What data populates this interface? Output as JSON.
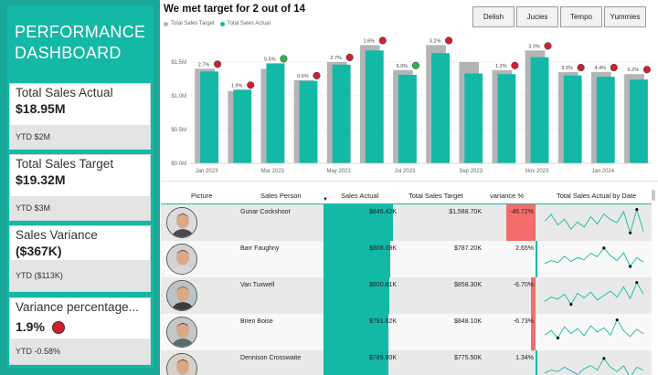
{
  "sidebar": {
    "title_line1": "PERFORMANCE",
    "title_line2": "DASHBOARD",
    "kpis": [
      {
        "label": "Total Sales Actual",
        "value": "$18.95M",
        "ytd": "YTD $2M"
      },
      {
        "label": "Total Sales Target",
        "value": "$19.32M",
        "ytd": "YTD $3M"
      },
      {
        "label": "Sales Variance",
        "value": "($367K)",
        "ytd": "YTD ($113K)"
      },
      {
        "label": "Variance percentage...",
        "value": "1.9%",
        "ytd": "YTD -0.58%",
        "status": "red"
      }
    ]
  },
  "slicers": [
    "Delish",
    "Jucies",
    "Tempo",
    "Yummies"
  ],
  "colors": {
    "target": "#b4b4b4",
    "actual": "#14b8a6",
    "good": "#2fb34a",
    "bad": "#d11f2f",
    "negative_variance": "#f46d6d"
  },
  "chart_data": {
    "type": "bar",
    "title": "We met target for 2 out of 14",
    "legend": [
      "Total Sales Target",
      "Total Sales Actual"
    ],
    "y_ticks": [
      "$0.0M",
      "$0.5M",
      "$1.0M",
      "$1.5M"
    ],
    "ylim": [
      0,
      1.85
    ],
    "x_tick_labels": [
      "Jan 2023",
      "",
      "Mar 2023",
      "",
      "May 2023",
      "",
      "Jul 2023",
      "",
      "Sep 2023",
      "",
      "Nov 2023",
      "",
      "Jan 2024",
      ""
    ],
    "series": [
      {
        "name": "Total Sales Target",
        "values": [
          1.4,
          1.07,
          1.4,
          1.23,
          1.5,
          1.75,
          1.38,
          1.75,
          1.5,
          1.38,
          1.67,
          1.35,
          1.35,
          1.32
        ]
      },
      {
        "name": "Total Sales Actual",
        "values": [
          1.36,
          1.09,
          1.48,
          1.22,
          1.46,
          1.67,
          1.31,
          1.63,
          1.33,
          1.32,
          1.57,
          1.3,
          1.28,
          1.24
        ]
      }
    ],
    "labels": [
      "2.7%",
      "1.9%",
      "5.5%",
      "0.6%",
      "2.7%",
      "1.6%",
      "5.0%",
      "3.2%",
      "",
      "1.2%",
      "3.3%",
      "3.5%",
      "4.4%",
      "6.2%"
    ],
    "status": [
      "bad",
      "bad",
      "good",
      "bad",
      "bad",
      "bad",
      "good",
      "bad",
      "none",
      "bad",
      "bad",
      "bad",
      "bad",
      "bad"
    ]
  },
  "table": {
    "headers": {
      "picture": "Picture",
      "sales_person": "Sales Person",
      "sales_actual": "Sales Actual",
      "sales_target": "Total Sales Target",
      "variance": "variance %",
      "by_date": "Total Sales Actual by Date"
    },
    "rows": [
      {
        "name": "Gunar Cockshoot",
        "actual": "$846.42K",
        "actual_val": 846.42,
        "target": "$1,588.70K",
        "variance": "-46.72%",
        "variance_val": -46.72,
        "spark": [
          0.55,
          0.78,
          0.42,
          0.62,
          0.28,
          0.52,
          0.35,
          0.7,
          0.45,
          0.8,
          0.6,
          0.5,
          0.88,
          0.15,
          0.95,
          0.2
        ],
        "spark_max": 14,
        "spark_min": 13
      },
      {
        "name": "Barr Faughny",
        "actual": "$808.09K",
        "actual_val": 808.09,
        "target": "$787.20K",
        "variance": "2.65%",
        "variance_val": 2.65,
        "spark": [
          0.35,
          0.45,
          0.38,
          0.6,
          0.42,
          0.55,
          0.48,
          0.7,
          0.58,
          0.88,
          0.62,
          0.45,
          0.72,
          0.25,
          0.55,
          0.4
        ],
        "spark_max": 9,
        "spark_min": 13
      },
      {
        "name": "Van Tuxwell",
        "actual": "$800.81K",
        "actual_val": 800.81,
        "target": "$858.30K",
        "variance": "-6.70%",
        "variance_val": -6.7,
        "spark": [
          0.3,
          0.45,
          0.38,
          0.55,
          0.2,
          0.58,
          0.42,
          0.62,
          0.35,
          0.5,
          0.65,
          0.45,
          0.8,
          0.4,
          0.95,
          0.55
        ],
        "spark_max": 14,
        "spark_min": 4
      },
      {
        "name": "Brien Boise",
        "actual": "$791.62K",
        "actual_val": 791.62,
        "target": "$848.10K",
        "variance": "-6.73%",
        "variance_val": -6.73,
        "spark": [
          0.4,
          0.55,
          0.3,
          0.68,
          0.45,
          0.62,
          0.38,
          0.72,
          0.5,
          0.65,
          0.4,
          0.92,
          0.55,
          0.35,
          0.6,
          0.45
        ],
        "spark_max": 11,
        "spark_min": 2
      },
      {
        "name": "Dennison Crosswaite",
        "actual": "$785.90K",
        "actual_val": 785.9,
        "target": "$775.50K",
        "variance": "1.34%",
        "variance_val": 1.34,
        "spark": [
          0.35,
          0.45,
          0.4,
          0.55,
          0.42,
          0.3,
          0.5,
          0.6,
          0.45,
          0.85,
          0.55,
          0.4,
          0.6,
          0.2,
          0.55,
          0.45
        ],
        "spark_max": 9,
        "spark_min": 13
      }
    ]
  }
}
